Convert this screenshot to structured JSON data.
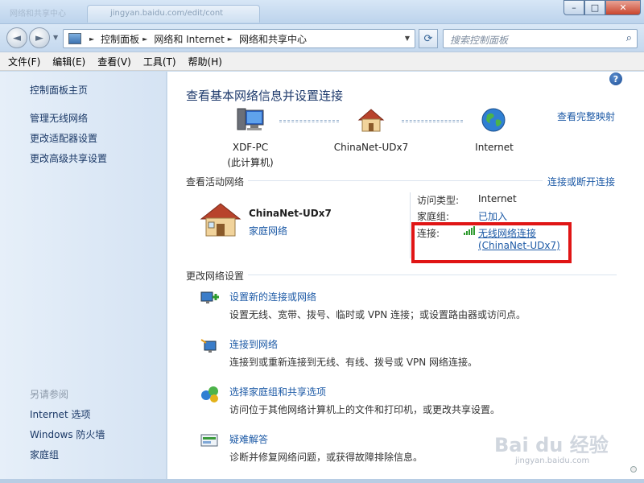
{
  "window": {
    "tab_text": "jingyan.baidu.com/edit/cont",
    "faint_title": "网络和共享中心",
    "minimize": "–",
    "maximize": "□",
    "close": "✕"
  },
  "navbar": {
    "back": "◄",
    "forward": "►",
    "breadcrumbs": [
      "控制面板",
      "网络和 Internet",
      "网络和共享中心"
    ],
    "refresh": "⟳",
    "search_placeholder": "搜索控制面板",
    "search_icon": "⌕"
  },
  "menu": [
    "文件(F)",
    "编辑(E)",
    "查看(V)",
    "工具(T)",
    "帮助(H)"
  ],
  "sidebar": {
    "home": "控制面板主页",
    "links": [
      "管理无线网络",
      "更改适配器设置",
      "更改高级共享设置"
    ],
    "see_also_title": "另请参阅",
    "see_also": [
      "Internet 选项",
      "Windows 防火墙",
      "家庭组"
    ]
  },
  "main": {
    "help": "?",
    "title": "查看基本网络信息并设置连接",
    "view_full_map": "查看完整映射",
    "nodes": [
      {
        "name": "XDF-PC",
        "sub": "(此计算机)"
      },
      {
        "name": "ChinaNet-UDx7",
        "sub": ""
      },
      {
        "name": "Internet",
        "sub": ""
      }
    ],
    "active_networks_title": "查看活动网络",
    "connect_disconnect": "连接或断开连接",
    "network": {
      "name": "ChinaNet-UDx7",
      "type": "家庭网络",
      "access_type_label": "访问类型:",
      "access_type_value": "Internet",
      "homegroup_label": "家庭组:",
      "homegroup_value": "已加入",
      "connection_label": "连接:",
      "connection_value": "无线网络连接",
      "connection_ssid": "(ChinaNet-UDx7)"
    },
    "change_settings_title": "更改网络设置",
    "tasks": [
      {
        "title": "设置新的连接或网络",
        "desc": "设置无线、宽带、拨号、临时或 VPN 连接；或设置路由器或访问点。"
      },
      {
        "title": "连接到网络",
        "desc": "连接到或重新连接到无线、有线、拨号或 VPN 网络连接。"
      },
      {
        "title": "选择家庭组和共享选项",
        "desc": "访问位于其他网络计算机上的文件和打印机，或更改共享设置。"
      },
      {
        "title": "疑难解答",
        "desc": "诊断并修复网络问题，或获得故障排除信息。"
      }
    ]
  },
  "watermark": {
    "logo": "Bai du 经验",
    "url": "jingyan.baidu.com"
  },
  "colors": {
    "link": "#1d5aa6",
    "highlight": "#e01515",
    "title": "#1e3a6c"
  }
}
